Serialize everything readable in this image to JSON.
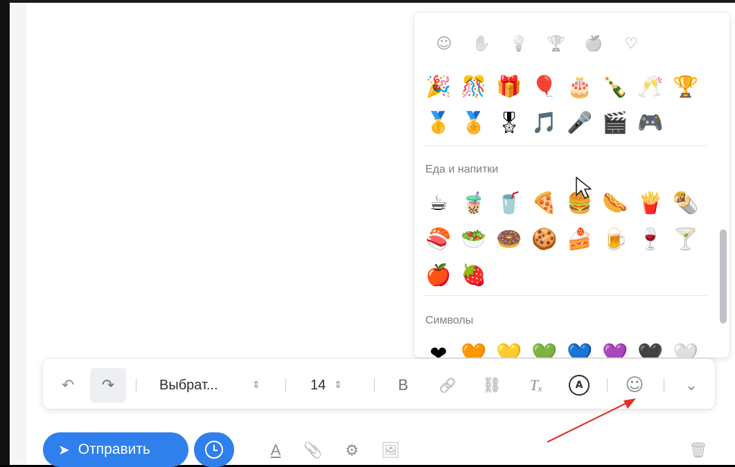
{
  "emoji_panel": {
    "category_tabs": [
      {
        "name": "smileys",
        "glyph": "☺"
      },
      {
        "name": "people",
        "glyph": "✋"
      },
      {
        "name": "objects",
        "glyph": "💡"
      },
      {
        "name": "activities",
        "glyph": "🏆"
      },
      {
        "name": "food",
        "glyph": "🍏"
      },
      {
        "name": "symbols",
        "glyph": "♡"
      }
    ],
    "activities_emojis": [
      "🎉",
      "🎊",
      "🎁",
      "🎈",
      "🎂",
      "🍾",
      "🥂",
      "🏆",
      "🥇",
      "🏅",
      "🎖",
      "🎵",
      "🎤",
      "🎬",
      "🎮"
    ],
    "food_section_title": "Еда и напитки",
    "food_emojis": [
      "☕",
      "🧋",
      "🥤",
      "🍕",
      "🍔",
      "🌭",
      "🍟",
      "🌯",
      "🍣",
      "🥗",
      "🍩",
      "🍪",
      "🍰",
      "🍺",
      "🍷",
      "🍸",
      "🍎",
      "🍓"
    ],
    "symbols_section_title": "Символы",
    "symbols_emojis": [
      "❤",
      "🧡",
      "💛",
      "💚",
      "💙",
      "💜",
      "🖤",
      "🤍"
    ],
    "scroll_position": 0.62
  },
  "toolbar": {
    "undo_icon": "↶",
    "redo_icon": "↷",
    "font_family_value": "Выбрат...",
    "font_size_value": "14",
    "spinner_glyph": "⇕",
    "bold_label": "B",
    "link_icon": "🔗",
    "unlink_icon": "⛓",
    "clear_format_label": "Tₓ",
    "autocorrect_label": "A",
    "emoji_icon": "☺",
    "more_icon": "⌄"
  },
  "actions": {
    "send_label": "Отправить",
    "send_icon": "➤",
    "text_format_icon": "A",
    "attach_icon": "📎",
    "attachment_alt_icon": "⚙",
    "image_icon": "🖼",
    "delete_icon": "🗑"
  },
  "colors": {
    "accent": "#2f80ed",
    "annotation_arrow": "#e0302a"
  }
}
